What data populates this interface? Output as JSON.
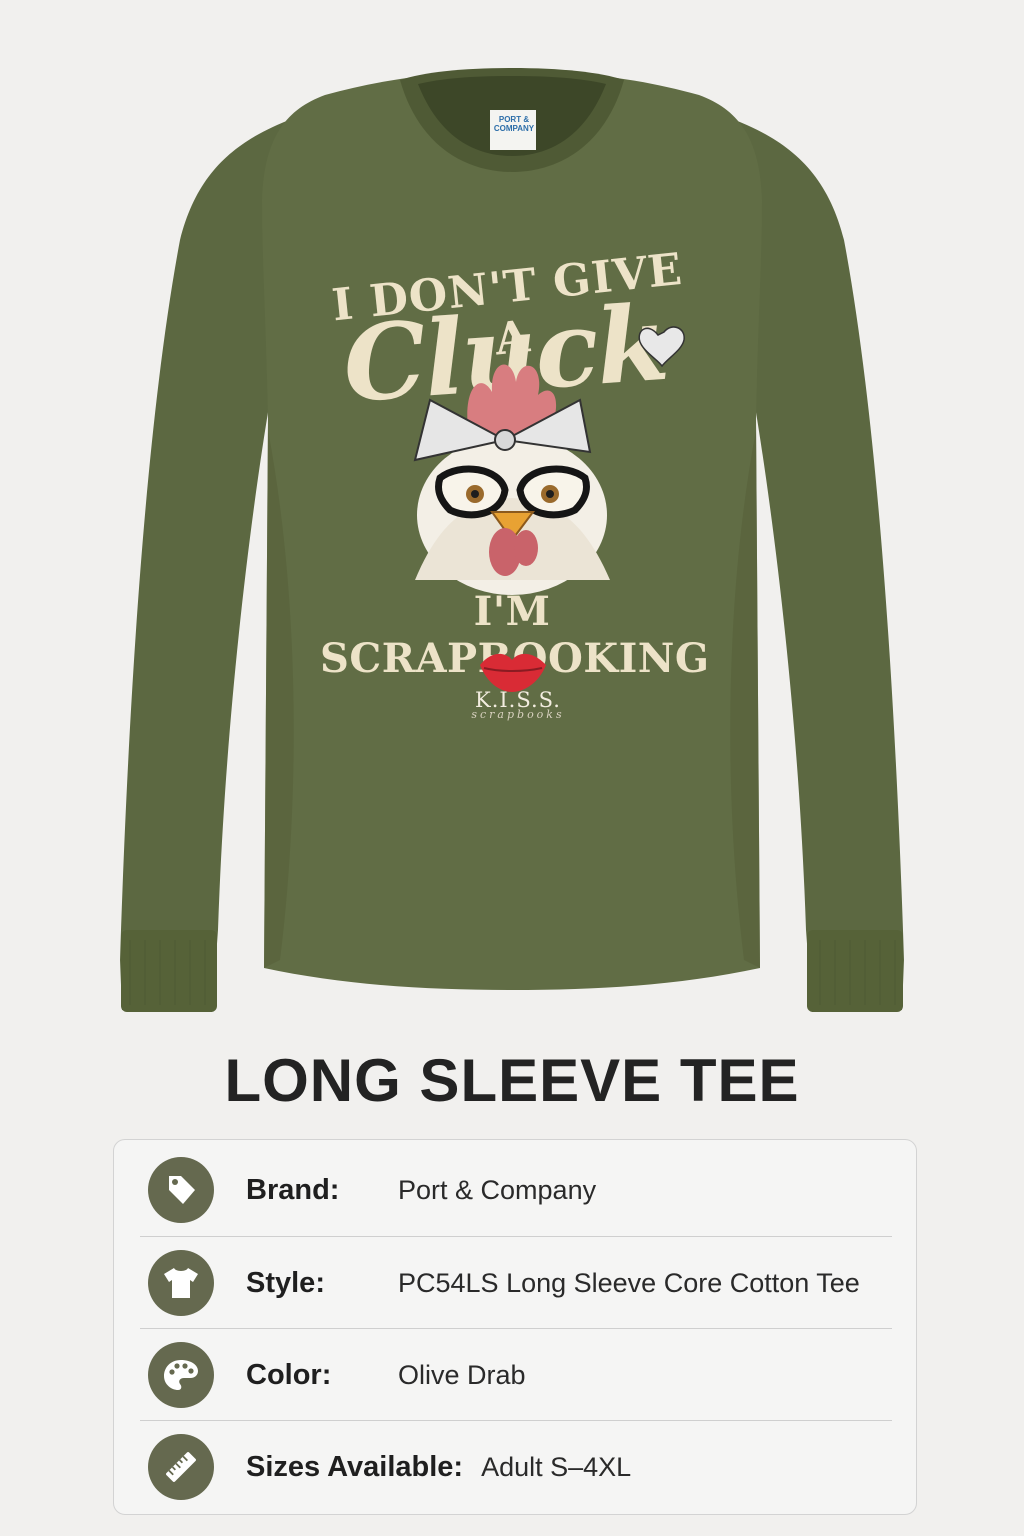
{
  "shirt": {
    "color": "#5f6b43",
    "neck_tag": "PORT & COMPANY",
    "print": {
      "line1": "I DON'T GIVE A",
      "script": "Cluck",
      "line3": "I'M SCRAPBOOKING",
      "logo_name": "K.I.S.S.",
      "logo_sub": "scrapbooks"
    }
  },
  "title": "LONG SLEEVE TEE",
  "specs": [
    {
      "icon": "tag-icon",
      "label": "Brand:",
      "value": "Port & Company"
    },
    {
      "icon": "tshirt-icon",
      "label": "Style:",
      "value": "PC54LS Long Sleeve Core Cotton Tee"
    },
    {
      "icon": "palette-icon",
      "label": "Color:",
      "value": "Olive Drab"
    },
    {
      "icon": "ruler-icon",
      "label": "Sizes Available:",
      "value": "Adult S–4XL"
    }
  ],
  "accent_color": "#65694f"
}
